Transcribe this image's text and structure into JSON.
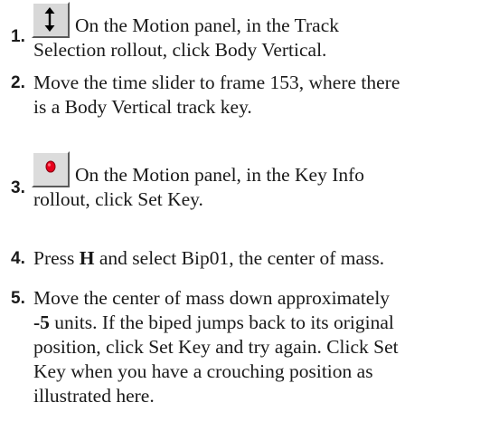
{
  "steps": [
    {
      "number": "1.",
      "icon": "body-vertical-icon",
      "lines": [
        "On the Motion panel, in the Track",
        "Selection rollout, click Body Vertical."
      ]
    },
    {
      "number": "2.",
      "lines": [
        "Move the time slider to frame 153, where there",
        "is a Body Vertical track key."
      ]
    },
    {
      "number": "3.",
      "icon": "set-key-icon",
      "lines": [
        "On the Motion panel, in the Key Info",
        "rollout, click Set Key."
      ]
    },
    {
      "number": "4.",
      "text_before": "Press ",
      "key": "H",
      "text_after": " and select Bip01, the center of mass."
    },
    {
      "number": "5.",
      "line1": "Move the center of mass down approximately",
      "amount": "-5",
      "line2_rest": " units. If the biped jumps back to its original",
      "line3": "position, click Set Key and try again. Click Set",
      "line4": "Key when you have a crouching position as",
      "line5": "illustrated here."
    }
  ],
  "colors": {
    "text": "#1a1a1a",
    "button_face": "#d8d8d8",
    "set_key_red": "#e8001c"
  }
}
